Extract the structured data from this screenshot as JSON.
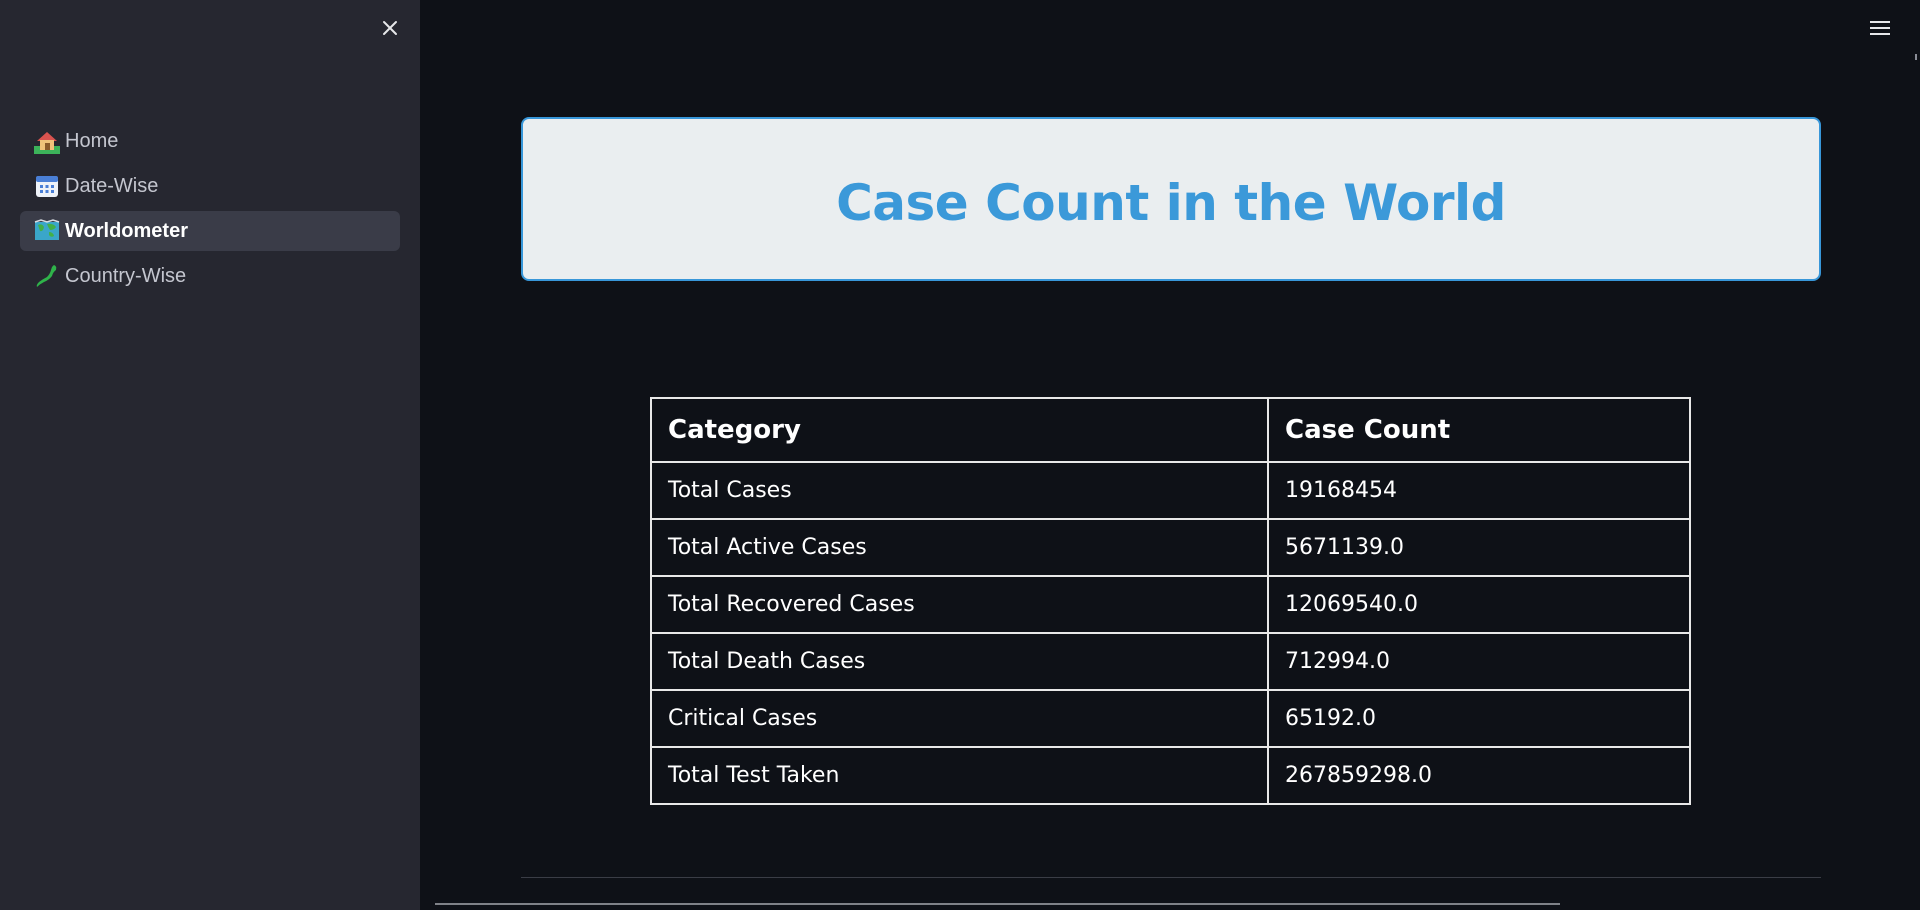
{
  "sidebar": {
    "close_icon": "close-icon",
    "items": [
      {
        "label": "Home",
        "icon": "house-icon",
        "active": false
      },
      {
        "label": "Date-Wise",
        "icon": "calendar-icon",
        "active": false
      },
      {
        "label": "Worldometer",
        "icon": "world-map-icon",
        "active": true
      },
      {
        "label": "Country-Wise",
        "icon": "japan-map-icon",
        "active": false
      }
    ]
  },
  "header": {
    "menu_icon": "hamburger-menu-icon"
  },
  "main": {
    "title": "Case Count in the World",
    "table": {
      "headers": [
        "Category",
        "Case Count"
      ],
      "rows": [
        [
          "Total Cases",
          "19168454"
        ],
        [
          "Total Active Cases",
          "5671139.0"
        ],
        [
          "Total Recovered Cases",
          "12069540.0"
        ],
        [
          "Total Death Cases",
          "712994.0"
        ],
        [
          "Critical Cases",
          "65192.0"
        ],
        [
          "Total Test Taken",
          "267859298.0"
        ]
      ]
    }
  },
  "colors": {
    "background": "#0e1117",
    "sidebar": "#262730",
    "title_text": "#3b99d9",
    "title_box": "#eaeef0",
    "title_border": "#3897d9"
  }
}
